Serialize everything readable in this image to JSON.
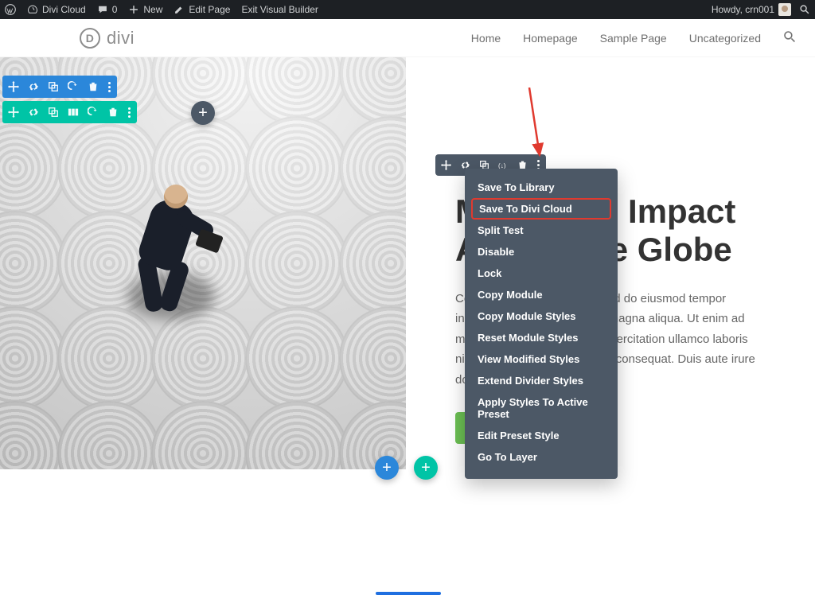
{
  "wpbar": {
    "site": "Divi Cloud",
    "comments": "0",
    "new": "New",
    "edit": "Edit Page",
    "exit": "Exit Visual Builder",
    "howdy": "Howdy, crn001"
  },
  "header": {
    "logo_text": "divi",
    "nav": [
      "Home",
      "Homepage",
      "Sample Page",
      "Uncategorized"
    ]
  },
  "hero": {
    "title_line1": "Making an Impact",
    "title_line2": "Across the Globe",
    "body": "Consectetur adipiscing elit, sed do eiusmod tempor incididunt ut labore et dolore magna aliqua. Ut enim ad minim veniam, quis nostrud exercitation ullamco laboris nisi ut aliquip ex ea commodo consequat. Duis aute irure dolor"
  },
  "context_menu": [
    "Save To Library",
    "Save To Divi Cloud",
    "Split Test",
    "Disable",
    "Lock",
    "Copy Module",
    "Copy Module Styles",
    "Reset Module Styles",
    "View Modified Styles",
    "Extend Divider Styles",
    "Apply Styles To Active Preset",
    "Edit Preset Style",
    "Go To Layer"
  ],
  "context_highlight_index": 1,
  "colors": {
    "section_blue": "#2b87da",
    "row_teal": "#00c4a6",
    "module_grey": "#4c5866",
    "highlight_red": "#e03a2f"
  }
}
